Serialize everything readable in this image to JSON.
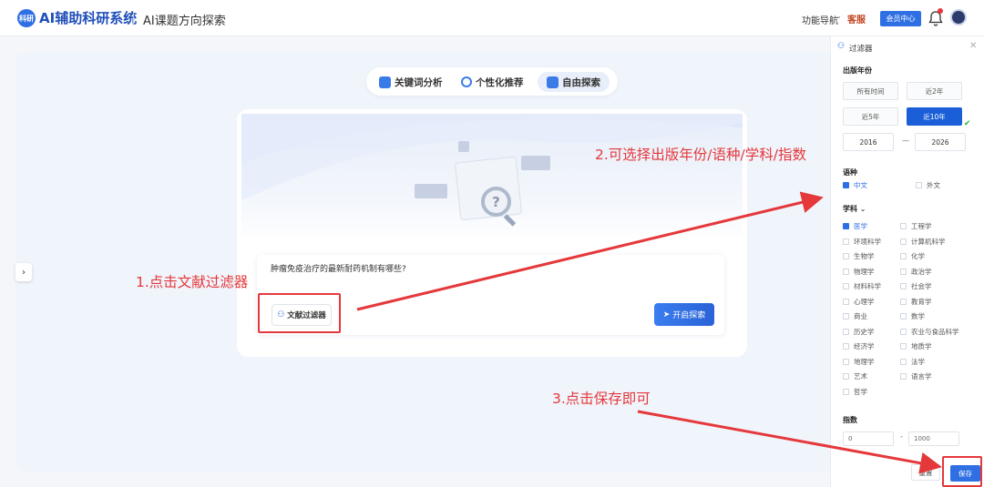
{
  "header": {
    "logo_text": "科研",
    "brand": "AI辅助科研系统",
    "subtitle": "AI课题方向探索",
    "nav_label": "功能导航",
    "service_label": "客服",
    "member_label": "会员中心"
  },
  "tabs": [
    {
      "label": "关键词分析"
    },
    {
      "label": "个性化推荐"
    },
    {
      "label": "自由探索"
    }
  ],
  "query": {
    "text": "肿瘤免疫治疗的最新耐药机制有哪些?"
  },
  "buttons": {
    "filter_label": "文献过滤器",
    "start_label": "开启探索"
  },
  "annotations": {
    "step1": "1.点击文献过滤器",
    "step2": "2.可选择出版年份/语种/学科/指数",
    "step3": "3.点击保存即可"
  },
  "filter": {
    "title": "过滤器",
    "year_label": "出版年份",
    "year_options": [
      "所有时间",
      "近2年",
      "近5年",
      "近10年"
    ],
    "year_selected": "近10年",
    "year_from": "2016",
    "year_to": "2026",
    "year_dash": "—",
    "lang_label": "语种",
    "languages": [
      {
        "label": "中文",
        "checked": true
      },
      {
        "label": "外文",
        "checked": false
      }
    ],
    "subject_label": "学科",
    "subjects": [
      {
        "label": "医学",
        "checked": true
      },
      {
        "label": "工程学",
        "checked": false
      },
      {
        "label": "环境科学",
        "checked": false
      },
      {
        "label": "计算机科学",
        "checked": false
      },
      {
        "label": "生物学",
        "checked": false
      },
      {
        "label": "化学",
        "checked": false
      },
      {
        "label": "物理学",
        "checked": false
      },
      {
        "label": "政治学",
        "checked": false
      },
      {
        "label": "材料科学",
        "checked": false
      },
      {
        "label": "社会学",
        "checked": false
      },
      {
        "label": "心理学",
        "checked": false
      },
      {
        "label": "教育学",
        "checked": false
      },
      {
        "label": "商业",
        "checked": false
      },
      {
        "label": "数学",
        "checked": false
      },
      {
        "label": "历史学",
        "checked": false
      },
      {
        "label": "农业与食品科学",
        "checked": false
      },
      {
        "label": "经济学",
        "checked": false
      },
      {
        "label": "地质学",
        "checked": false
      },
      {
        "label": "地理学",
        "checked": false
      },
      {
        "label": "法学",
        "checked": false
      },
      {
        "label": "艺术",
        "checked": false
      },
      {
        "label": "语言学",
        "checked": false
      },
      {
        "label": "哲学",
        "checked": false
      }
    ],
    "index_label": "指数",
    "index_min": "0",
    "index_max": "1000",
    "index_dash": "-",
    "reset_label": "重置",
    "save_label": "保存"
  },
  "colors": {
    "accent": "#2f6fe4",
    "annotation": "#e5383b"
  }
}
